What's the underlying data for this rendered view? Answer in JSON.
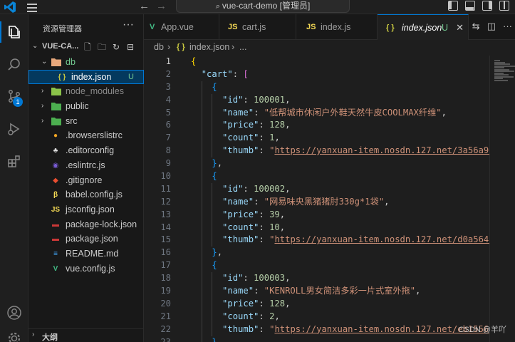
{
  "titlebar": {
    "search_text": "vue-cart-demo [管理员]",
    "back_glyph": "←",
    "forward_glyph": "→"
  },
  "activity_bar": {
    "items": [
      {
        "icon": "explorer-icon"
      },
      {
        "icon": "search-icon"
      },
      {
        "icon": "source-control-icon",
        "badge": "1"
      },
      {
        "icon": "run-debug-icon"
      },
      {
        "icon": "extensions-icon"
      },
      {
        "icon": "account-icon"
      },
      {
        "icon": "settings-gear-icon"
      }
    ]
  },
  "sidebar": {
    "title": "资源管理器",
    "more": "···",
    "project": "VUE-CA...",
    "outline": "大纲",
    "tree": [
      {
        "name": "db",
        "type": "folder-open",
        "depth": 1,
        "icon_color": "#e8a87c",
        "text_color": "#73c991"
      },
      {
        "name": "index.json",
        "type": "file",
        "depth": 2,
        "icon": "{ }",
        "icon_color": "#cbcb41",
        "status": "U",
        "selected": true,
        "text_color": "#ffffff"
      },
      {
        "name": "node_modules",
        "type": "folder",
        "depth": 1,
        "icon_color": "#8bc34a",
        "text_color": "#8b8b8b"
      },
      {
        "name": "public",
        "type": "folder",
        "depth": 1,
        "icon_color": "#4caf50",
        "text_color": "#cccccc"
      },
      {
        "name": "src",
        "type": "folder",
        "depth": 1,
        "icon_color": "#4caf50",
        "text_color": "#cccccc"
      },
      {
        "name": ".browserslistrc",
        "type": "file",
        "depth": 1,
        "icon": "●",
        "icon_color": "#f5a623",
        "text_color": "#cccccc"
      },
      {
        "name": ".editorconfig",
        "type": "file",
        "depth": 1,
        "icon": "♣",
        "icon_color": "#e0e0e0",
        "text_color": "#cccccc"
      },
      {
        "name": ".eslintrc.js",
        "type": "file",
        "depth": 1,
        "icon": "◉",
        "icon_color": "#7a5cd6",
        "text_color": "#cccccc"
      },
      {
        "name": ".gitignore",
        "type": "file",
        "depth": 1,
        "icon": "◆",
        "icon_color": "#e94e31",
        "text_color": "#cccccc"
      },
      {
        "name": "babel.config.js",
        "type": "file",
        "depth": 1,
        "icon": "β",
        "icon_color": "#f5da55",
        "text_color": "#cccccc"
      },
      {
        "name": "jsconfig.json",
        "type": "file",
        "depth": 1,
        "icon": "JS",
        "icon_color": "#f5da55",
        "text_color": "#cccccc"
      },
      {
        "name": "package-lock.json",
        "type": "file",
        "depth": 1,
        "icon": "▬",
        "icon_color": "#cb3837",
        "text_color": "#cccccc"
      },
      {
        "name": "package.json",
        "type": "file",
        "depth": 1,
        "icon": "▬",
        "icon_color": "#cb3837",
        "text_color": "#cccccc"
      },
      {
        "name": "README.md",
        "type": "file",
        "depth": 1,
        "icon": "≡",
        "icon_color": "#42a5f5",
        "text_color": "#cccccc"
      },
      {
        "name": "vue.config.js",
        "type": "file",
        "depth": 1,
        "icon": "V",
        "icon_color": "#41b883",
        "text_color": "#cccccc"
      }
    ]
  },
  "tabs": [
    {
      "label": "App.vue",
      "icon": "V",
      "icon_color": "#41b883"
    },
    {
      "label": "cart.js",
      "icon": "JS",
      "icon_color": "#f5da55"
    },
    {
      "label": "index.js",
      "icon": "JS",
      "icon_color": "#f5da55"
    },
    {
      "label": "index.json",
      "icon": "{ }",
      "icon_color": "#cbcb41",
      "status": "U",
      "active": true,
      "close": "✕"
    }
  ],
  "breadcrumb": {
    "folder": "db",
    "sep": "›",
    "file_icon": "{ }",
    "file": "index.json",
    "more": "..."
  },
  "editor": {
    "lines": [
      "{",
      "  \"cart\": [",
      "    {",
      "      \"id\": 100001,",
      "      \"name\": \"低帮城市休闲户外鞋天然牛皮COOLMAX纤维\",",
      "      \"price\": 128,",
      "      \"count\": 1,",
      "      \"thumb\": \"https://yanxuan-item.nosdn.127.net/3a56a91",
      "    },",
      "    {",
      "      \"id\": 100002,",
      "      \"name\": \"网易味央黑猪猪肘330g*1袋\",",
      "      \"price\": 39,",
      "      \"count\": 10,",
      "      \"thumb\": \"https://yanxuan-item.nosdn.127.net/d0a5647",
      "    },",
      "    {",
      "      \"id\": 100003,",
      "      \"name\": \"KENROLL男女简洁多彩一片式室外拖\",",
      "      \"price\": 128,",
      "      \"count\": 2,",
      "      \"thumb\": \"https://yanxuan-item.nosdn.127.net/eb1556f",
      "    },"
    ],
    "line_numbers": [
      "1",
      "2",
      "3",
      "4",
      "5",
      "6",
      "7",
      "8",
      "9",
      "10",
      "11",
      "12",
      "13",
      "14",
      "15",
      "16",
      "17",
      "18",
      "19",
      "20",
      "21",
      "22",
      "23"
    ]
  },
  "watermark": "CSDN @羊吖"
}
